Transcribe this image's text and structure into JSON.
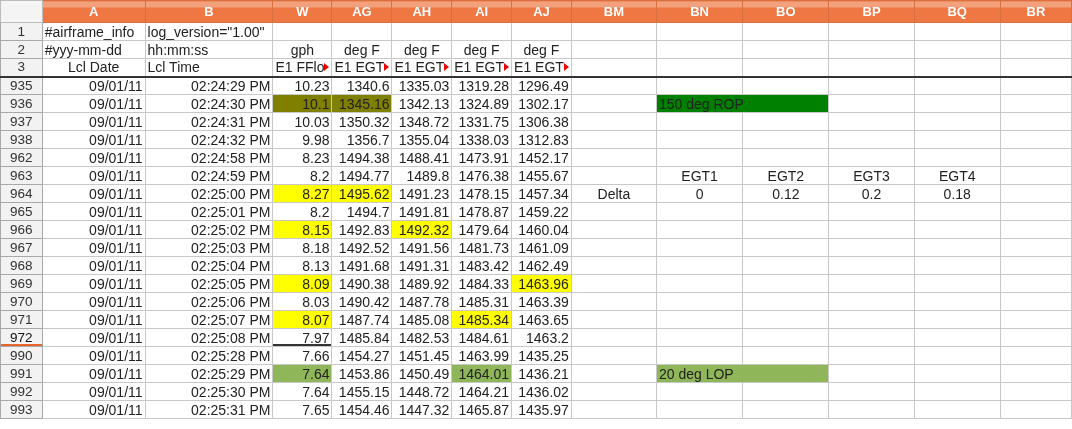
{
  "columns": [
    {
      "label": "A"
    },
    {
      "label": "B"
    },
    {
      "label": "W"
    },
    {
      "label": "AG"
    },
    {
      "label": "AH"
    },
    {
      "label": "AI"
    },
    {
      "label": "AJ"
    },
    {
      "label": "BM"
    },
    {
      "label": "BN"
    },
    {
      "label": "BO"
    },
    {
      "label": "BP"
    },
    {
      "label": "BQ"
    },
    {
      "label": "BR"
    }
  ],
  "rows": [
    {
      "number": "1",
      "selected": false,
      "cells": {
        "A": {
          "text": "#airframe_info",
          "kind": "text"
        },
        "B": {
          "text": "log_version=\"1.00\"",
          "kind": "text"
        }
      }
    },
    {
      "number": "2",
      "selected": false,
      "cells": {
        "A": {
          "text": "#yyy-mm-dd",
          "kind": "text"
        },
        "B": {
          "text": "hh:mm:ss",
          "kind": "text"
        },
        "W": {
          "text": "gph",
          "kind": "center"
        },
        "AG": {
          "text": "deg F",
          "kind": "center"
        },
        "AH": {
          "text": "deg F",
          "kind": "center"
        },
        "AI": {
          "text": "deg F",
          "kind": "center"
        },
        "AJ": {
          "text": "deg F",
          "kind": "center"
        }
      }
    },
    {
      "number": "3",
      "selected": false,
      "frozen_below": true,
      "cells": {
        "A": {
          "text": "Lcl Date",
          "kind": "center"
        },
        "B": {
          "text": "Lcl Time",
          "kind": "text"
        },
        "W": {
          "text": "E1 FFlo",
          "kind": "clipped"
        },
        "AG": {
          "text": "E1 EGT",
          "kind": "clipped"
        },
        "AH": {
          "text": "E1 EGT",
          "kind": "clipped"
        },
        "AI": {
          "text": "E1 EGT",
          "kind": "clipped"
        },
        "AJ": {
          "text": "E1 EGT",
          "kind": "clipped"
        }
      }
    },
    {
      "number": "935",
      "selected": false,
      "cells": {
        "A": {
          "text": "09/01/11",
          "kind": "number"
        },
        "B": {
          "text": "02:24:29 PM",
          "kind": "number"
        },
        "W": {
          "text": "10.23",
          "kind": "number"
        },
        "AG": {
          "text": "1340.6",
          "kind": "number"
        },
        "AH": {
          "text": "1335.03",
          "kind": "number"
        },
        "AI": {
          "text": "1319.28",
          "kind": "number"
        },
        "AJ": {
          "text": "1296.49",
          "kind": "number"
        }
      }
    },
    {
      "number": "936",
      "selected": false,
      "cells": {
        "A": {
          "text": "09/01/11",
          "kind": "number"
        },
        "B": {
          "text": "02:24:30 PM",
          "kind": "number"
        },
        "W": {
          "text": "10.1",
          "kind": "number",
          "color": "#808000"
        },
        "AG": {
          "text": "1345.16",
          "kind": "number",
          "color": "#808000"
        },
        "AH": {
          "text": "1342.13",
          "kind": "number"
        },
        "AI": {
          "text": "1324.89",
          "kind": "number"
        },
        "AJ": {
          "text": "1302.17",
          "kind": "number"
        },
        "BN": {
          "text": "150 deg ROP",
          "kind": "merged",
          "color": "#008000"
        }
      }
    },
    {
      "number": "937",
      "selected": false,
      "cells": {
        "A": {
          "text": "09/01/11",
          "kind": "number"
        },
        "B": {
          "text": "02:24:31 PM",
          "kind": "number"
        },
        "W": {
          "text": "10.03",
          "kind": "number"
        },
        "AG": {
          "text": "1350.32",
          "kind": "number"
        },
        "AH": {
          "text": "1348.72",
          "kind": "number"
        },
        "AI": {
          "text": "1331.75",
          "kind": "number"
        },
        "AJ": {
          "text": "1306.38",
          "kind": "number"
        }
      }
    },
    {
      "number": "938",
      "selected": false,
      "cells": {
        "A": {
          "text": "09/01/11",
          "kind": "number"
        },
        "B": {
          "text": "02:24:32 PM",
          "kind": "number"
        },
        "W": {
          "text": "9.98",
          "kind": "number"
        },
        "AG": {
          "text": "1356.7",
          "kind": "number"
        },
        "AH": {
          "text": "1355.04",
          "kind": "number"
        },
        "AI": {
          "text": "1338.03",
          "kind": "number"
        },
        "AJ": {
          "text": "1312.83",
          "kind": "number"
        }
      }
    },
    {
      "number": "962",
      "selected": false,
      "cells": {
        "A": {
          "text": "09/01/11",
          "kind": "number"
        },
        "B": {
          "text": "02:24:58 PM",
          "kind": "number"
        },
        "W": {
          "text": "8.23",
          "kind": "number"
        },
        "AG": {
          "text": "1494.38",
          "kind": "number"
        },
        "AH": {
          "text": "1488.41",
          "kind": "number"
        },
        "AI": {
          "text": "1473.91",
          "kind": "number"
        },
        "AJ": {
          "text": "1452.17",
          "kind": "number"
        }
      }
    },
    {
      "number": "963",
      "selected": false,
      "cells": {
        "A": {
          "text": "09/01/11",
          "kind": "number"
        },
        "B": {
          "text": "02:24:59 PM",
          "kind": "number"
        },
        "W": {
          "text": "8.2",
          "kind": "number"
        },
        "AG": {
          "text": "1494.77",
          "kind": "number"
        },
        "AH": {
          "text": "1489.8",
          "kind": "number"
        },
        "AI": {
          "text": "1476.38",
          "kind": "number"
        },
        "AJ": {
          "text": "1455.67",
          "kind": "number"
        },
        "BN": {
          "text": "EGT1",
          "kind": "center"
        },
        "BO": {
          "text": "EGT2",
          "kind": "center"
        },
        "BP": {
          "text": "EGT3",
          "kind": "center"
        },
        "BQ": {
          "text": "EGT4",
          "kind": "center"
        }
      }
    },
    {
      "number": "964",
      "selected": false,
      "cells": {
        "A": {
          "text": "09/01/11",
          "kind": "number"
        },
        "B": {
          "text": "02:25:00 PM",
          "kind": "number"
        },
        "W": {
          "text": "8.27",
          "kind": "number",
          "color": "#ffff00"
        },
        "AG": {
          "text": "1495.62",
          "kind": "number",
          "color": "#ffff00"
        },
        "AH": {
          "text": "1491.23",
          "kind": "number"
        },
        "AI": {
          "text": "1478.15",
          "kind": "number"
        },
        "AJ": {
          "text": "1457.34",
          "kind": "number"
        },
        "BM": {
          "text": "Delta",
          "kind": "center"
        },
        "BN": {
          "text": "0",
          "kind": "center"
        },
        "BO": {
          "text": "0.12",
          "kind": "center"
        },
        "BP": {
          "text": "0.2",
          "kind": "center"
        },
        "BQ": {
          "text": "0.18",
          "kind": "center"
        }
      }
    },
    {
      "number": "965",
      "selected": false,
      "cells": {
        "A": {
          "text": "09/01/11",
          "kind": "number"
        },
        "B": {
          "text": "02:25:01 PM",
          "kind": "number"
        },
        "W": {
          "text": "8.2",
          "kind": "number"
        },
        "AG": {
          "text": "1494.7",
          "kind": "number"
        },
        "AH": {
          "text": "1491.81",
          "kind": "number"
        },
        "AI": {
          "text": "1478.87",
          "kind": "number"
        },
        "AJ": {
          "text": "1459.22",
          "kind": "number"
        }
      }
    },
    {
      "number": "966",
      "selected": false,
      "cells": {
        "A": {
          "text": "09/01/11",
          "kind": "number"
        },
        "B": {
          "text": "02:25:02 PM",
          "kind": "number"
        },
        "W": {
          "text": "8.15",
          "kind": "number",
          "color": "#ffff00"
        },
        "AG": {
          "text": "1492.83",
          "kind": "number"
        },
        "AH": {
          "text": "1492.32",
          "kind": "number",
          "color": "#ffff00"
        },
        "AI": {
          "text": "1479.64",
          "kind": "number"
        },
        "AJ": {
          "text": "1460.04",
          "kind": "number"
        }
      }
    },
    {
      "number": "967",
      "selected": false,
      "cells": {
        "A": {
          "text": "09/01/11",
          "kind": "number"
        },
        "B": {
          "text": "02:25:03 PM",
          "kind": "number"
        },
        "W": {
          "text": "8.18",
          "kind": "number"
        },
        "AG": {
          "text": "1492.52",
          "kind": "number"
        },
        "AH": {
          "text": "1491.56",
          "kind": "number"
        },
        "AI": {
          "text": "1481.73",
          "kind": "number"
        },
        "AJ": {
          "text": "1461.09",
          "kind": "number"
        }
      }
    },
    {
      "number": "968",
      "selected": false,
      "cells": {
        "A": {
          "text": "09/01/11",
          "kind": "number"
        },
        "B": {
          "text": "02:25:04 PM",
          "kind": "number"
        },
        "W": {
          "text": "8.13",
          "kind": "number"
        },
        "AG": {
          "text": "1491.68",
          "kind": "number"
        },
        "AH": {
          "text": "1491.31",
          "kind": "number"
        },
        "AI": {
          "text": "1483.42",
          "kind": "number"
        },
        "AJ": {
          "text": "1462.49",
          "kind": "number"
        }
      }
    },
    {
      "number": "969",
      "selected": false,
      "cells": {
        "A": {
          "text": "09/01/11",
          "kind": "number"
        },
        "B": {
          "text": "02:25:05 PM",
          "kind": "number"
        },
        "W": {
          "text": "8.09",
          "kind": "number",
          "color": "#ffff00"
        },
        "AG": {
          "text": "1490.38",
          "kind": "number"
        },
        "AH": {
          "text": "1489.92",
          "kind": "number"
        },
        "AI": {
          "text": "1484.33",
          "kind": "number"
        },
        "AJ": {
          "text": "1463.96",
          "kind": "number",
          "color": "#ffff00"
        }
      }
    },
    {
      "number": "970",
      "selected": false,
      "cells": {
        "A": {
          "text": "09/01/11",
          "kind": "number"
        },
        "B": {
          "text": "02:25:06 PM",
          "kind": "number"
        },
        "W": {
          "text": "8.03",
          "kind": "number"
        },
        "AG": {
          "text": "1490.42",
          "kind": "number"
        },
        "AH": {
          "text": "1487.78",
          "kind": "number"
        },
        "AI": {
          "text": "1485.31",
          "kind": "number"
        },
        "AJ": {
          "text": "1463.39",
          "kind": "number"
        }
      }
    },
    {
      "number": "971",
      "selected": false,
      "cells": {
        "A": {
          "text": "09/01/11",
          "kind": "number"
        },
        "B": {
          "text": "02:25:07 PM",
          "kind": "number"
        },
        "W": {
          "text": "8.07",
          "kind": "number",
          "color": "#ffff00"
        },
        "AG": {
          "text": "1487.74",
          "kind": "number"
        },
        "AH": {
          "text": "1485.08",
          "kind": "number"
        },
        "AI": {
          "text": "1485.34",
          "kind": "number",
          "color": "#ffff00"
        },
        "AJ": {
          "text": "1463.65",
          "kind": "number"
        }
      }
    },
    {
      "number": "972",
      "selected": true,
      "cells": {
        "A": {
          "text": "09/01/11",
          "kind": "number"
        },
        "B": {
          "text": "02:25:08 PM",
          "kind": "number"
        },
        "W": {
          "text": "7.97",
          "kind": "cursor"
        },
        "AG": {
          "text": "1485.84",
          "kind": "number"
        },
        "AH": {
          "text": "1482.53",
          "kind": "number"
        },
        "AI": {
          "text": "1484.61",
          "kind": "number"
        },
        "AJ": {
          "text": "1463.2",
          "kind": "number"
        }
      }
    },
    {
      "number": "990",
      "selected": false,
      "cells": {
        "A": {
          "text": "09/01/11",
          "kind": "number"
        },
        "B": {
          "text": "02:25:28 PM",
          "kind": "number"
        },
        "W": {
          "text": "7.66",
          "kind": "number"
        },
        "AG": {
          "text": "1454.27",
          "kind": "number"
        },
        "AH": {
          "text": "1451.45",
          "kind": "number"
        },
        "AI": {
          "text": "1463.99",
          "kind": "number"
        },
        "AJ": {
          "text": "1435.25",
          "kind": "number"
        }
      }
    },
    {
      "number": "991",
      "selected": false,
      "cells": {
        "A": {
          "text": "09/01/11",
          "kind": "number"
        },
        "B": {
          "text": "02:25:29 PM",
          "kind": "number"
        },
        "W": {
          "text": "7.64",
          "kind": "number",
          "color": "#8fb75a"
        },
        "AG": {
          "text": "1453.86",
          "kind": "number"
        },
        "AH": {
          "text": "1450.49",
          "kind": "number"
        },
        "AI": {
          "text": "1464.01",
          "kind": "number",
          "color": "#8fb75a"
        },
        "AJ": {
          "text": "1436.21",
          "kind": "number"
        },
        "BN": {
          "text": "20 deg LOP",
          "kind": "merged",
          "color": "#8fb75a"
        }
      }
    },
    {
      "number": "992",
      "selected": false,
      "cells": {
        "A": {
          "text": "09/01/11",
          "kind": "number"
        },
        "B": {
          "text": "02:25:30 PM",
          "kind": "number"
        },
        "W": {
          "text": "7.64",
          "kind": "number"
        },
        "AG": {
          "text": "1455.15",
          "kind": "number"
        },
        "AH": {
          "text": "1448.72",
          "kind": "number"
        },
        "AI": {
          "text": "1464.21",
          "kind": "number"
        },
        "AJ": {
          "text": "1436.02",
          "kind": "number"
        }
      }
    },
    {
      "number": "993",
      "selected": false,
      "cells": {
        "A": {
          "text": "09/01/11",
          "kind": "number"
        },
        "B": {
          "text": "02:25:31 PM",
          "kind": "number"
        },
        "W": {
          "text": "7.65",
          "kind": "number"
        },
        "AG": {
          "text": "1454.46",
          "kind": "number"
        },
        "AH": {
          "text": "1447.32",
          "kind": "number"
        },
        "AI": {
          "text": "1465.87",
          "kind": "number"
        },
        "AJ": {
          "text": "1435.97",
          "kind": "number"
        }
      }
    }
  ]
}
